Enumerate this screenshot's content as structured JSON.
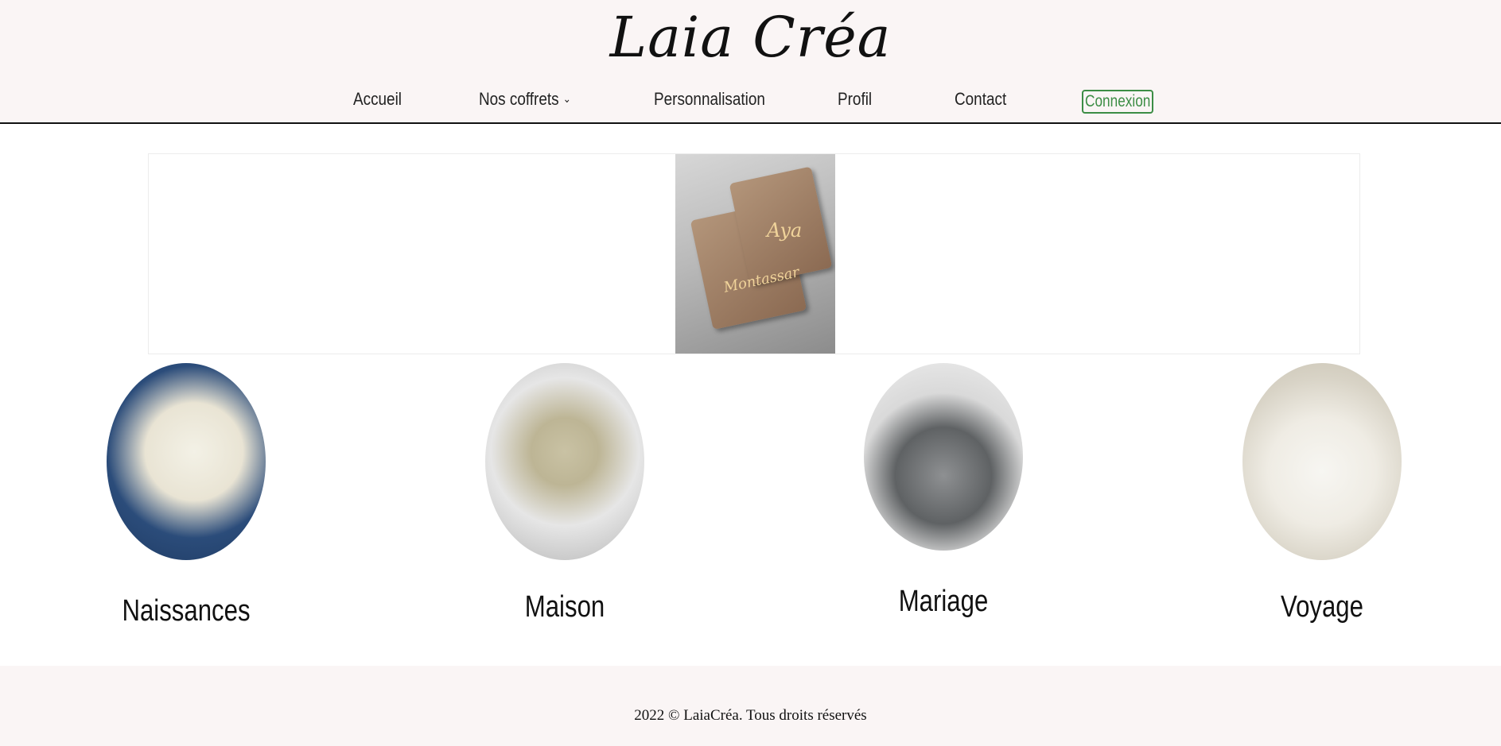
{
  "brand": "Laia Créa",
  "nav": {
    "items": [
      {
        "label": "Accueil"
      },
      {
        "label": "Nos coffrets"
      },
      {
        "label": "Personnalisation"
      },
      {
        "label": "Profil"
      },
      {
        "label": "Contact"
      }
    ],
    "login_label": "Connexion"
  },
  "carousel": {
    "image_text_1": "Aya",
    "image_text_2": "Montassar"
  },
  "categories": [
    {
      "label": "Naissances"
    },
    {
      "label": "Maison"
    },
    {
      "label": "Mariage"
    },
    {
      "label": "Voyage"
    }
  ],
  "footer": {
    "copyright": "2022 © LaiaCréa. Tous droits réservés"
  },
  "colors": {
    "header_bg": "#faf5f5",
    "accent_green": "#3c8d45"
  }
}
